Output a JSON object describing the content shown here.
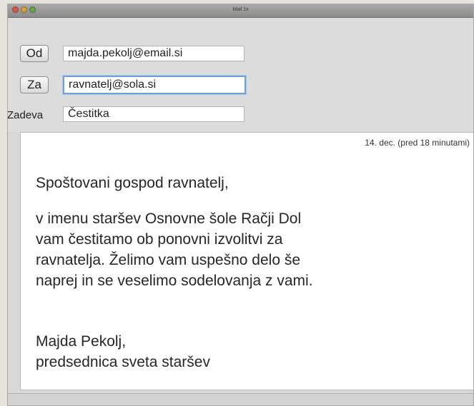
{
  "window": {
    "title": "Mail 1x"
  },
  "header": {
    "from_button": "Od",
    "from_value": "majda.pekolj@email.si",
    "to_button": "Za",
    "to_value": "ravnatelj@sola.si",
    "subject_label": "Zadeva",
    "subject_value": "Čestitka"
  },
  "message": {
    "timestamp": "14. dec. (pred 18 minutami)",
    "greeting": "Spoštovani gospod ravnatelj,",
    "body_lines": [
      "v imenu staršev Osnovne šole Račji Dol",
      "vam čestitamo ob ponovni izvolitvi za",
      "ravnatelja. Želimo vam uspešno delo še",
      "naprej in se veselimo sodelovanja z vami."
    ],
    "signature_lines": [
      "Majda Pekolj,",
      "predsednica sveta staršev"
    ]
  }
}
